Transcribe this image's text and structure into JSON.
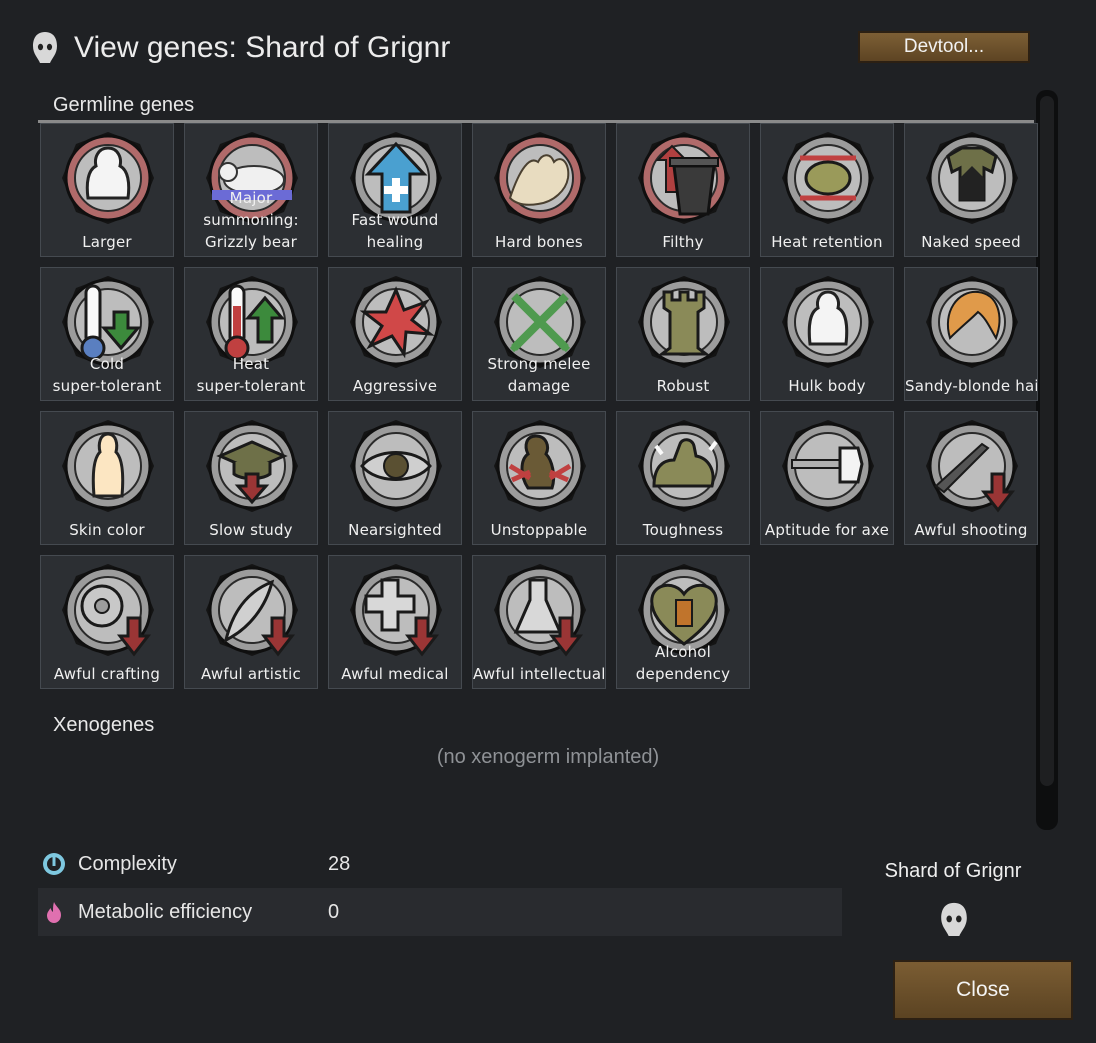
{
  "window": {
    "title": "View genes: Shard of Grignr",
    "devtool_label": "Devtool...",
    "close_label": "Close"
  },
  "germline": {
    "heading": "Germline genes",
    "genes": [
      {
        "label": "Larger",
        "icon": "larger-icon",
        "ring": "#b06a6a"
      },
      {
        "label": "Major\nsummoning:\nGrizzly bear",
        "icon": "bear-icon",
        "ring": "#b06a6a"
      },
      {
        "label": "Fast wound\nhealing",
        "icon": "healing-arrow-icon",
        "ring": "#9c9c9c"
      },
      {
        "label": "Hard bones",
        "icon": "bones-icon",
        "ring": "#b06a6a"
      },
      {
        "label": "Filthy",
        "icon": "trash-can-icon",
        "ring": "#b06a6a"
      },
      {
        "label": "Heat retention",
        "icon": "brain-heat-icon",
        "ring": "#9c9c9c"
      },
      {
        "label": "Naked speed",
        "icon": "naked-speed-icon",
        "ring": "#9c9c9c"
      },
      {
        "label": "Cold\nsuper-tolerant",
        "icon": "thermometer-cold-icon",
        "ring": "#9c9c9c"
      },
      {
        "label": "Heat\nsuper-tolerant",
        "icon": "thermometer-hot-icon",
        "ring": "#9c9c9c"
      },
      {
        "label": "Aggressive",
        "icon": "burst-icon",
        "ring": "#9c9c9c"
      },
      {
        "label": "Strong melee\ndamage",
        "icon": "crossed-swords-icon",
        "ring": "#9c9c9c"
      },
      {
        "label": "Robust",
        "icon": "tower-icon",
        "ring": "#9c9c9c"
      },
      {
        "label": "Hulk body",
        "icon": "hulk-body-icon",
        "ring": "#9c9c9c"
      },
      {
        "label": "Sandy-blonde hair",
        "icon": "hair-icon",
        "ring": "#9c9c9c"
      },
      {
        "label": "Skin color",
        "icon": "skin-color-icon",
        "ring": "#9c9c9c"
      },
      {
        "label": "Slow study",
        "icon": "graduation-cap-icon",
        "ring": "#9c9c9c"
      },
      {
        "label": "Nearsighted",
        "icon": "eye-icon",
        "ring": "#9c9c9c"
      },
      {
        "label": "Unstoppable",
        "icon": "unstoppable-icon",
        "ring": "#9c9c9c"
      },
      {
        "label": "Toughness",
        "icon": "flexed-arm-icon",
        "ring": "#9c9c9c"
      },
      {
        "label": "Aptitude for axe",
        "icon": "axe-icon",
        "ring": "#9c9c9c"
      },
      {
        "label": "Awful shooting",
        "icon": "rifle-down-icon",
        "ring": "#9c9c9c"
      },
      {
        "label": "Awful crafting",
        "icon": "gear-down-icon",
        "ring": "#9c9c9c"
      },
      {
        "label": "Awful artistic",
        "icon": "quill-down-icon",
        "ring": "#9c9c9c"
      },
      {
        "label": "Awful medical",
        "icon": "cross-down-icon",
        "ring": "#9c9c9c"
      },
      {
        "label": "Awful intellectual",
        "icon": "flask-down-icon",
        "ring": "#9c9c9c"
      },
      {
        "label": "Alcohol\ndependency",
        "icon": "heart-bottle-icon",
        "ring": "#9c9c9c"
      }
    ]
  },
  "xenogenes": {
    "heading": "Xenogenes",
    "empty_text": "(no xenogerm implanted)"
  },
  "stats": [
    {
      "name": "Complexity",
      "value": "28",
      "icon": "complexity-icon",
      "color": "#7ec8e0"
    },
    {
      "name": "Metabolic efficiency",
      "value": "0",
      "icon": "flame-icon",
      "color": "#e070b0"
    }
  ],
  "pawn": {
    "name": "Shard of Grignr",
    "icon": "head-silhouette-icon"
  }
}
